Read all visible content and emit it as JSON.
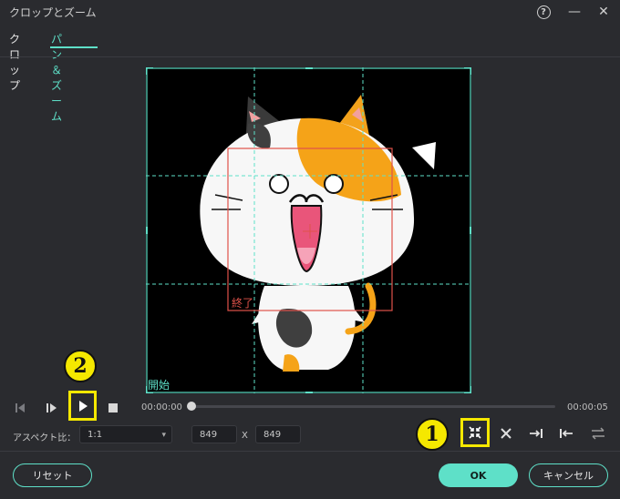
{
  "window": {
    "title": "クロップとズーム"
  },
  "tabs": [
    {
      "label": "クロップ"
    },
    {
      "label": "パン＆ズーム"
    }
  ],
  "canvas": {
    "start_label": "開始",
    "end_label": "終了"
  },
  "playback": {
    "current_time": "00:00:00",
    "end_time": "00:00:05"
  },
  "aspect": {
    "label": "アスペクト比：",
    "value": "1:1",
    "width": "849",
    "separator": "X",
    "height": "849"
  },
  "annotations": {
    "badge1": "1",
    "badge2": "2"
  },
  "buttons": {
    "reset": "リセット",
    "ok": "OK",
    "cancel": "キャンセル"
  },
  "colors": {
    "accent": "#5ee0c8",
    "highlight": "#f5e800",
    "end_rect": "#e0524a"
  },
  "icons": {
    "help": "help-icon",
    "minimize": "minimize-icon",
    "close": "close-icon",
    "step_back": "step-back-icon",
    "step_forward": "step-forward-icon",
    "play": "play-icon",
    "stop": "stop-icon",
    "swap_zoom": "swap-zoom-icon",
    "expand": "expand-icon",
    "to_end": "to-end-icon",
    "to_start": "to-start-icon",
    "swap": "swap-arrows-icon"
  }
}
